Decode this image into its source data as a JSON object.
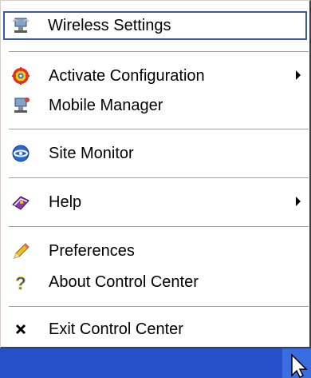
{
  "menu": {
    "items": [
      {
        "label": "Wireless Settings",
        "icon": "wireless-settings-icon"
      },
      {
        "label": "Activate Configuration",
        "icon": "target-icon",
        "submenu": true
      },
      {
        "label": "Mobile Manager",
        "icon": "mobile-manager-icon"
      },
      {
        "label": "Site Monitor",
        "icon": "site-monitor-icon"
      },
      {
        "label": "Help",
        "icon": "help-book-icon",
        "submenu": true
      },
      {
        "label": "Preferences",
        "icon": "pencil-icon"
      },
      {
        "label": "About Control Center",
        "icon": "question-icon"
      },
      {
        "label": "Exit Control Center",
        "icon": "close-x-icon"
      }
    ]
  },
  "colors": {
    "focus_border": "#3b5aa6",
    "taskbar": "#2451c7"
  }
}
